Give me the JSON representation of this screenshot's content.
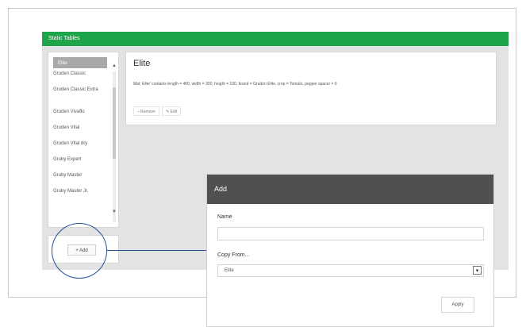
{
  "app": {
    "title": "Static Tables"
  },
  "list": {
    "selected": "Elite",
    "items": [
      "Gruden Classic",
      "Gruden Classic Extra",
      "Gruden Vivaflo",
      "Gruden Vital",
      "Gruden Vital dry",
      "Gruby Expert",
      "Gruby Master",
      "Gruby Master Jr."
    ],
    "scroll_up": "▲",
    "scroll_down": "▼"
  },
  "add_panel": {
    "add_label": "+ Add"
  },
  "detail": {
    "title": "Elite",
    "description": "Mat: Elite' contains length = 400, width = 300, height = 100, brand = Gruden Elite, crop = Tomato, pepper spacer = 0",
    "remove_label": "– Remove",
    "edit_label": "✎ Edit"
  },
  "dialog": {
    "title": "Add",
    "name_label": "Name",
    "name_value": "",
    "copy_label": "Copy From...",
    "copy_value": "Elite",
    "apply_label": "Apply"
  },
  "icons": {
    "select_arrow": "▾"
  },
  "colors": {
    "brand": "#1ea44a",
    "dialog_header": "#505050",
    "callout": "#1f4e96"
  }
}
